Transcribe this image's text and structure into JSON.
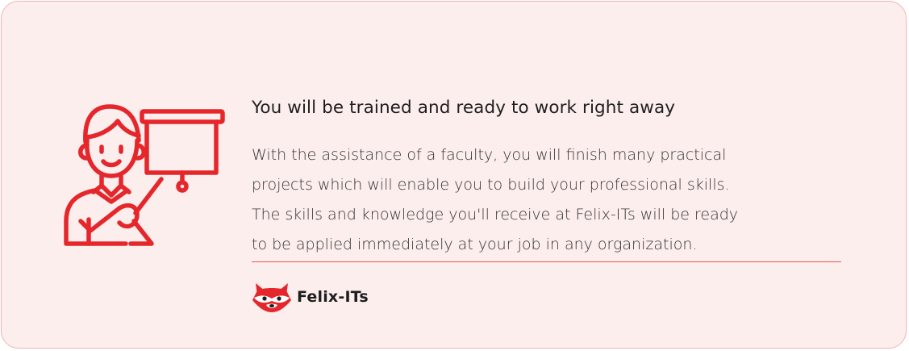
{
  "card": {
    "title": "You will be trained and ready to work right away",
    "body_lines": [
      "With the assistance of a faculty, you will finish many practical",
      "projects which will enable you to build your professional skills.",
      "The skills and knowledge you'll receive at Felix-ITs will be ready",
      "to be applied immediately at your job in any organization."
    ],
    "illustration_icon": "trainer-presentation-icon",
    "brand": {
      "name": "Felix-ITs",
      "logo_icon": "raccoon-logo-icon"
    }
  },
  "colors": {
    "accent": "#e5262b",
    "card_background": "#fdeeee",
    "card_border": "#f1b3b3",
    "title_text": "#1e1e1e",
    "body_text": "#333333"
  }
}
